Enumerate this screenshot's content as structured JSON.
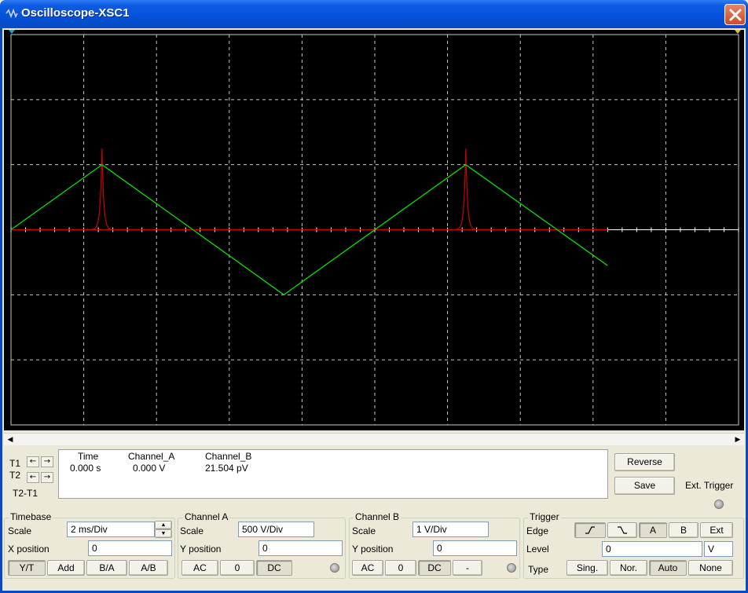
{
  "window": {
    "title": "Oscilloscope-XSC1"
  },
  "readout": {
    "t1_label": "T1",
    "t2_label": "T2",
    "t2t1_label": "T2-T1",
    "headers": {
      "time": "Time",
      "channel_a": "Channel_A",
      "channel_b": "Channel_B"
    },
    "t1_values": {
      "time": "0.000 s",
      "channel_a": "0.000 V",
      "channel_b": "21.504 pV"
    }
  },
  "buttons": {
    "reverse": "Reverse",
    "save": "Save",
    "ext_trigger": "Ext. Trigger"
  },
  "timebase": {
    "title": "Timebase",
    "scale_label": "Scale",
    "scale_value": "2 ms/Div",
    "xpos_label": "X position",
    "xpos_value": "0",
    "modes": [
      "Y/T",
      "Add",
      "B/A",
      "A/B"
    ],
    "active_mode": "Y/T"
  },
  "channel_a": {
    "title": "Channel A",
    "scale_label": "Scale",
    "scale_value": "500  V/Div",
    "ypos_label": "Y position",
    "ypos_value": "0",
    "coupling": [
      "AC",
      "0",
      "DC"
    ],
    "active_coupling": "DC"
  },
  "channel_b": {
    "title": "Channel B",
    "scale_label": "Scale",
    "scale_value": "1  V/Div",
    "ypos_label": "Y position",
    "ypos_value": "0",
    "coupling": [
      "AC",
      "0",
      "DC",
      "-"
    ],
    "active_coupling": "DC"
  },
  "trigger": {
    "title": "Trigger",
    "edge_label": "Edge",
    "edge_rising": "ƒ",
    "edge_falling": "Ʒ",
    "sources": [
      "A",
      "B",
      "Ext"
    ],
    "active_source": "A",
    "level_label": "Level",
    "level_value": "0",
    "level_unit": "V",
    "type_label": "Type",
    "types": [
      "Sing.",
      "Nor.",
      "Auto",
      "None"
    ],
    "active_type": "Auto"
  },
  "colors": {
    "trace_a": "#00e000",
    "trace_b": "#cc0000",
    "grid": "#c8c8c8",
    "screen_bg": "#000000"
  },
  "plot": {
    "channel_a": {
      "shape": "triangle",
      "scale_v_per_div": 500,
      "points_div": [
        [
          0,
          0
        ],
        [
          1.25,
          1
        ],
        [
          3.75,
          -1
        ],
        [
          6.25,
          1
        ],
        [
          8.2,
          -0.55
        ]
      ]
    },
    "channel_b": {
      "shape": "spike",
      "scale_v_per_div": 1,
      "spike_x_div": [
        1.25,
        6.25
      ],
      "spike_height_div": 1.25,
      "trace_end_div": 8.2
    }
  }
}
